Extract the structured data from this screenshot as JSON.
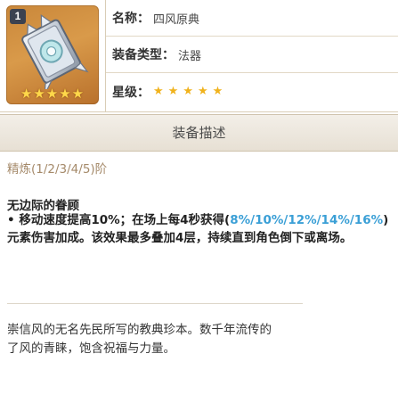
{
  "item": {
    "level_badge": "1",
    "name_label": "名称",
    "name_value": "四风原典",
    "type_label": "装备类型",
    "type_value": "法器",
    "rarity_label": "星级",
    "rarity_value": 5,
    "rarity_max": 5,
    "tile_background": "#c9873a",
    "star_color": "#f0b21c"
  },
  "section": {
    "title": "装备描述"
  },
  "description": {
    "refinement": "精炼(1/2/3/4/5)阶",
    "effect_title": "无边际的眷顾",
    "effect_part1": "• 移动速度提高10%；在场上每4秒获得(",
    "effect_highlight": "8%/10%/12%/14%/16%",
    "effect_part2": ")元素伤害加成。该效果最多叠加4层，持续直到角色倒下或离场。",
    "highlight_color": "#3a9fd6",
    "lore_line1": "崇信风的无名先民所写的教典珍本。数千年流传的",
    "lore_line2": "了风的青睐，饱含祝福与力量。"
  }
}
